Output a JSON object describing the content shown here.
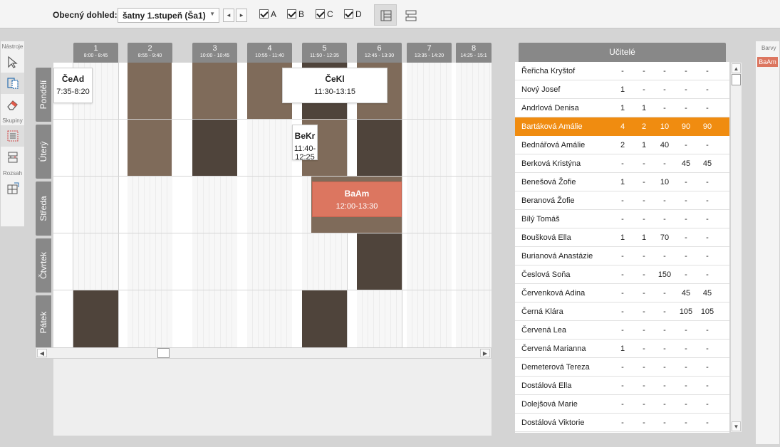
{
  "toolbar": {
    "label": "Obecný dohled:",
    "select_value": "šatny 1.stupeň (Ša1)",
    "prev_icon": "◂",
    "next_icon": "▸",
    "checkboxes": [
      {
        "label": "A",
        "checked": true
      },
      {
        "label": "B",
        "checked": true
      },
      {
        "label": "C",
        "checked": true
      },
      {
        "label": "D",
        "checked": true
      }
    ]
  },
  "tools": {
    "section_tools": "Nástroje",
    "section_groups": "Skupiny",
    "section_range": "Rozsah"
  },
  "periods": [
    {
      "num": "1",
      "time": "8:00 - 8:45"
    },
    {
      "num": "2",
      "time": "8:55 - 9:40"
    },
    {
      "num": "3",
      "time": "10:00 - 10:45"
    },
    {
      "num": "4",
      "time": "10:55 - 11:40"
    },
    {
      "num": "5",
      "time": "11:50 - 12:35"
    },
    {
      "num": "6",
      "time": "12:45 - 13:30"
    },
    {
      "num": "7",
      "time": "13:35 - 14:20"
    },
    {
      "num": "8",
      "time": "14:25 - 15:1"
    }
  ],
  "days": [
    "Pondělí",
    "Úterý",
    "Středa",
    "Čtvrtek",
    "Pátek"
  ],
  "cards": [
    {
      "abbr": "ČeAd",
      "time": "7:35-8:20"
    },
    {
      "abbr": "ČeKl",
      "time": "11:30-13:15"
    },
    {
      "abbr": "BeKr",
      "time": "11:40-12:25"
    },
    {
      "abbr": "BaAm",
      "time": "12:00-13:30"
    }
  ],
  "teachers": {
    "title": "Učitelé",
    "rows": [
      {
        "name": "Řeřicha Kryštof",
        "v": [
          "-",
          "-",
          "-",
          "-",
          "-"
        ]
      },
      {
        "name": "Nový Josef",
        "v": [
          "1",
          "-",
          "-",
          "-",
          "-"
        ]
      },
      {
        "name": "Andrlová Denisa",
        "v": [
          "1",
          "1",
          "-",
          "-",
          "-"
        ]
      },
      {
        "name": "Bartáková Amálie",
        "v": [
          "4",
          "2",
          "10",
          "90",
          "90"
        ],
        "selected": true
      },
      {
        "name": "Bednářová Amálie",
        "v": [
          "2",
          "1",
          "40",
          "-",
          "-"
        ]
      },
      {
        "name": "Berková Kristýna",
        "v": [
          "-",
          "-",
          "-",
          "45",
          "45"
        ]
      },
      {
        "name": "Benešová Žofie",
        "v": [
          "1",
          "-",
          "10",
          "-",
          "-"
        ]
      },
      {
        "name": "Beranová Žofie",
        "v": [
          "-",
          "-",
          "-",
          "-",
          "-"
        ]
      },
      {
        "name": "Bílý Tomáš",
        "v": [
          "-",
          "-",
          "-",
          "-",
          "-"
        ]
      },
      {
        "name": "Boušková Ella",
        "v": [
          "1",
          "1",
          "70",
          "-",
          "-"
        ]
      },
      {
        "name": "Burianová Anastázie",
        "v": [
          "-",
          "-",
          "-",
          "-",
          "-"
        ]
      },
      {
        "name": "Česlová Soňa",
        "v": [
          "-",
          "-",
          "150",
          "-",
          "-"
        ]
      },
      {
        "name": "Červenková Adina",
        "v": [
          "-",
          "-",
          "-",
          "45",
          "45"
        ]
      },
      {
        "name": "Černá Klára",
        "v": [
          "-",
          "-",
          "-",
          "105",
          "105"
        ]
      },
      {
        "name": "Červená Lea",
        "v": [
          "-",
          "-",
          "-",
          "-",
          "-"
        ]
      },
      {
        "name": "Červená Marianna",
        "v": [
          "1",
          "-",
          "-",
          "-",
          "-"
        ]
      },
      {
        "name": "Demeterová Tereza",
        "v": [
          "-",
          "-",
          "-",
          "-",
          "-"
        ]
      },
      {
        "name": "Dostálová Ella",
        "v": [
          "-",
          "-",
          "-",
          "-",
          "-"
        ]
      },
      {
        "name": "Dolejšová Marie",
        "v": [
          "-",
          "-",
          "-",
          "-",
          "-"
        ]
      },
      {
        "name": "Dostálová Viktorie",
        "v": [
          "-",
          "-",
          "-",
          "-",
          "-"
        ]
      }
    ]
  },
  "colors": {
    "label": "Barvy",
    "swatch_label": "BaAm",
    "accent": "#f08c10",
    "highlight": "#dc7660",
    "block_dark": "#4f443b",
    "block_mid": "#7f6b5a"
  }
}
